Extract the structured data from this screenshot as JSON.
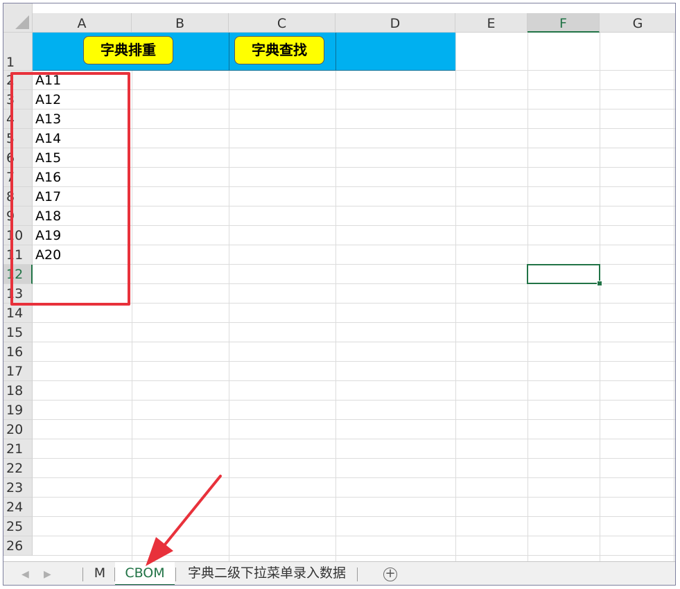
{
  "columns": [
    "A",
    "B",
    "C",
    "D",
    "E",
    "F",
    "G"
  ],
  "selected_column": "F",
  "rows": [
    "1",
    "2",
    "3",
    "4",
    "5",
    "6",
    "7",
    "8",
    "9",
    "10",
    "11",
    "12",
    "13",
    "14",
    "15",
    "16",
    "17",
    "18",
    "19",
    "20",
    "21",
    "22",
    "23",
    "24",
    "25",
    "26"
  ],
  "selected_row": "12",
  "buttons": {
    "dedupe": "字典排重",
    "lookup": "字典查找"
  },
  "column_a_values": [
    "A11",
    "A12",
    "A13",
    "A14",
    "A15",
    "A16",
    "A17",
    "A18",
    "A19",
    "A20"
  ],
  "sheet_tabs": [
    "M",
    "CBOM",
    "字典二级下拉菜单录入数据"
  ],
  "active_tab": "CBOM",
  "add_sheet_symbol": "+",
  "nav": {
    "prev": "◀",
    "next": "▶"
  },
  "colors": {
    "header_fill": "#00b0f0",
    "button_fill": "#ffff00",
    "annotation_red": "#e8313b",
    "excel_green": "#217346"
  }
}
